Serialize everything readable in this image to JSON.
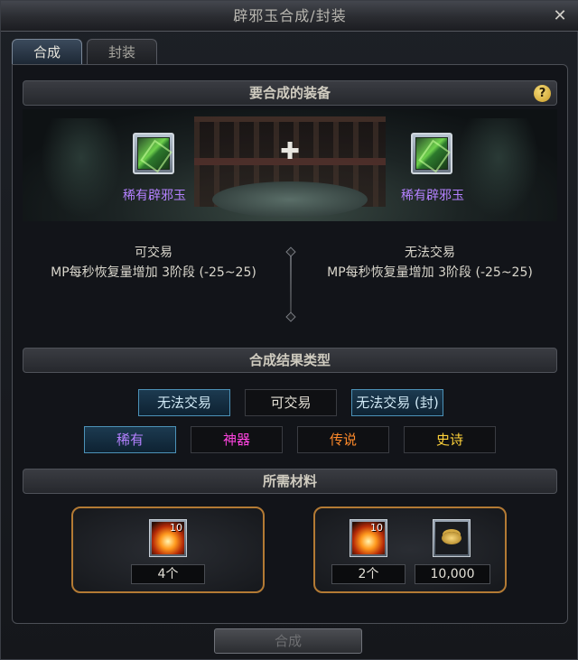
{
  "window": {
    "title": "辟邪玉合成/封装",
    "close_glyph": "✕"
  },
  "tabs": [
    {
      "label": "合成",
      "active": true
    },
    {
      "label": "封装",
      "active": false
    }
  ],
  "equip_section": {
    "title": "要合成的装备",
    "help_glyph": "?",
    "left_item": {
      "name": "稀有辟邪玉",
      "icon": "jade-gem-icon",
      "trade": "可交易",
      "stat": "MP每秒恢复量增加 3阶段 (-25~25)"
    },
    "right_item": {
      "name": "稀有辟邪玉",
      "icon": "jade-gem-icon",
      "trade": "无法交易",
      "stat": "MP每秒恢复量增加 3阶段 (-25~25)"
    },
    "plus_glyph": "✚"
  },
  "result_section": {
    "title": "合成结果类型",
    "trade_options": [
      {
        "label": "无法交易",
        "selected": true
      },
      {
        "label": "可交易",
        "selected": false
      },
      {
        "label": "无法交易 (封)",
        "selected": true
      }
    ],
    "rarity_options": [
      {
        "label": "稀有",
        "color": "#b481ff",
        "selected": true
      },
      {
        "label": "神器",
        "color": "#ff44e0",
        "selected": false
      },
      {
        "label": "传说",
        "color": "#ff8a2a",
        "selected": false
      },
      {
        "label": "史诗",
        "color": "#ffd23a",
        "selected": false
      }
    ]
  },
  "materials_section": {
    "title": "所需材料",
    "left": {
      "icon": "flame-stone-icon",
      "stack": "10",
      "qty": "4个"
    },
    "right": {
      "icon": "flame-stone-icon",
      "stack": "10",
      "qty": "2个",
      "gold_icon": "gold-coins-icon",
      "gold": "10,000"
    }
  },
  "craft_button": "合成"
}
